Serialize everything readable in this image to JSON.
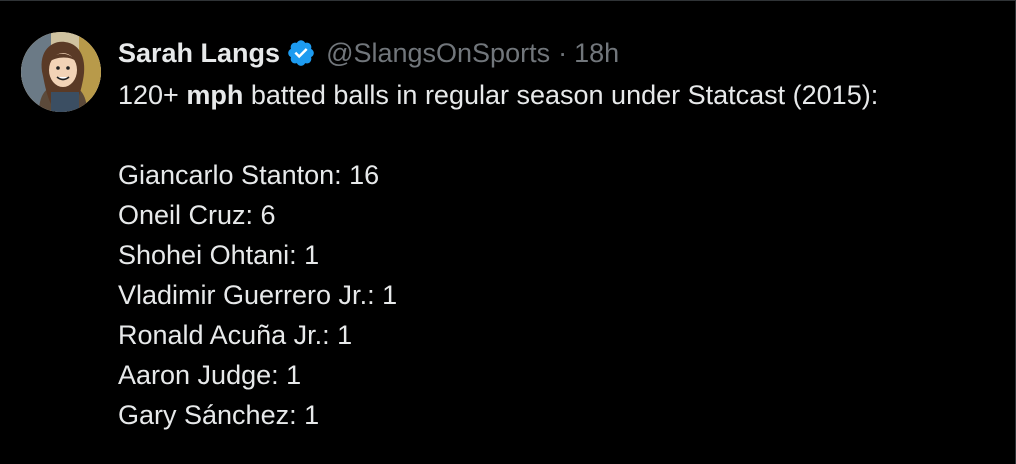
{
  "author": {
    "display_name": "Sarah Langs",
    "handle": "@SlangsOnSports",
    "separator": "·",
    "time": "18h"
  },
  "icons": {
    "verified": "verified-badge-icon",
    "avatar": "avatar-illustration"
  },
  "colors": {
    "background": "#000000",
    "text": "#e7e9ea",
    "muted": "#71767b",
    "verified_blue": "#1d9bf0"
  },
  "tweet": {
    "intro_prefix": "120+ ",
    "intro_bold": "mph",
    "intro_suffix": " batted balls in regular season under Statcast (2015):",
    "list": [
      "Giancarlo Stanton: 16",
      "Oneil Cruz: 6",
      "Shohei Ohtani: 1",
      "Vladimir Guerrero Jr.: 1",
      "Ronald Acuña Jr.: 1",
      "Aaron Judge: 1",
      "Gary Sánchez: 1"
    ]
  }
}
